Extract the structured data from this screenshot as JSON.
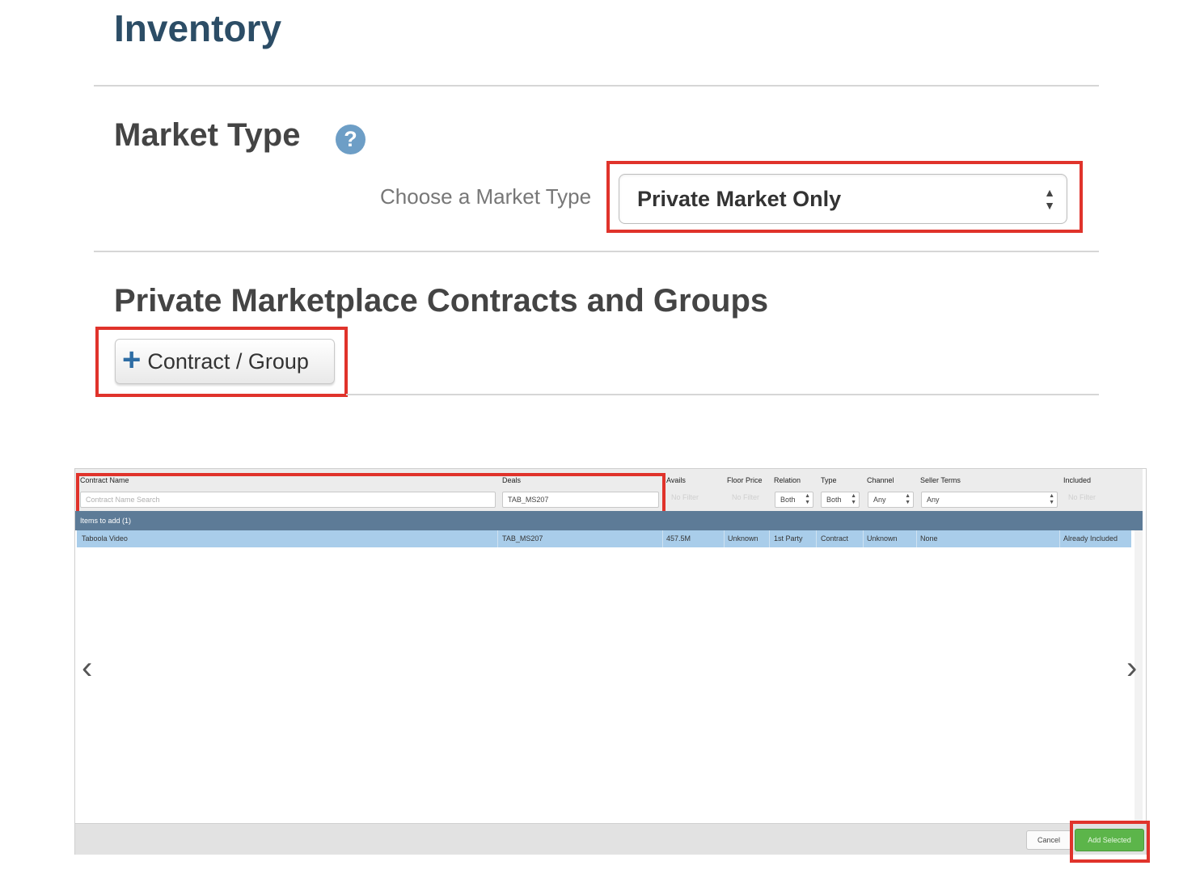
{
  "page": {
    "title": "Inventory"
  },
  "market_type": {
    "heading": "Market Type",
    "help_icon": "question-circle-icon",
    "choose_label": "Choose a Market Type",
    "selected_value": "Private Market Only"
  },
  "pmp": {
    "heading": "Private Marketplace Contracts and Groups",
    "add_button_label": "Contract / Group",
    "add_button_icon": "plus-icon"
  },
  "dialog": {
    "columns": {
      "contract_name": "Contract Name",
      "deals": "Deals",
      "avails": "Avails",
      "floor_price": "Floor Price",
      "relation": "Relation",
      "type": "Type",
      "channel": "Channel",
      "seller_terms": "Seller Terms",
      "included": "Included"
    },
    "filters": {
      "contract_name_placeholder": "Contract Name Search",
      "deals_value": "TAB_MS207",
      "avails_placeholder": "No Filter",
      "floor_price_placeholder": "No Filter",
      "relation_value": "Both",
      "type_value": "Both",
      "channel_value": "Any",
      "seller_terms_value": "Any",
      "included_placeholder": "No Filter"
    },
    "group_label": "Items to add (1)",
    "row": {
      "contract_name": "Taboola Video",
      "deals": "TAB_MS207",
      "avails": "457.5M",
      "floor_price": "Unknown",
      "relation": "1st Party",
      "type": "Contract",
      "channel": "Unknown",
      "seller_terms": "None",
      "included": "Already Included"
    },
    "cancel_label": "Cancel",
    "add_selected_label": "Add Selected"
  },
  "colors": {
    "title": "#2c4d66",
    "highlight_box": "#e0332b",
    "group_bar": "#5d7b97",
    "selected_row": "#a9cdea",
    "add_selected": "#5cb54a"
  }
}
